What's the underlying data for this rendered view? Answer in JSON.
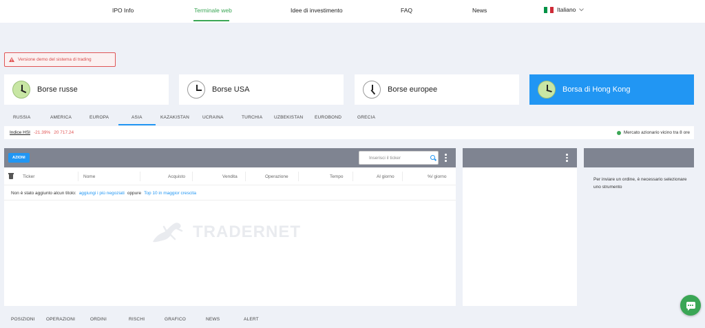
{
  "nav": {
    "items": [
      "IPO Info",
      "Terminale web",
      "Idee di investimento",
      "FAQ",
      "News"
    ],
    "active": "Terminale web",
    "language": "Italiano",
    "flag_colors": [
      "#009246",
      "#ffffff",
      "#ce2b37"
    ]
  },
  "demo_banner": "Versione demo del sistema di trading",
  "exchanges": [
    {
      "label": "Borse russe",
      "icon": "clock-icon"
    },
    {
      "label": "Borse USA",
      "icon": "clock-icon"
    },
    {
      "label": "Borse europee",
      "icon": "clock-icon"
    },
    {
      "label": "Borsa di Hong Kong",
      "icon": "clock-icon",
      "active": true
    }
  ],
  "market_tabs": [
    "RUSSIA",
    "AMERICA",
    "EUROPA",
    "ASIA",
    "KAZAKISTAN",
    "UCRAINA",
    "TURCHIA",
    "UZBEKISTAN",
    "EUROBOND",
    "GRECIA"
  ],
  "active_market_tab": "ASIA",
  "index": {
    "name": "Indice HSI",
    "change": "-21.39%",
    "value": "20 717.24"
  },
  "market_status": "Mercato azionario vicino tra 8 ore",
  "table": {
    "button": "AZIONI",
    "search_placeholder": "Inserisci il ticker",
    "columns": [
      "Ticker",
      "Nome",
      "Acquisto",
      "Vendita",
      "Operazione",
      "Tempo",
      "Al giorno",
      "%/ giorno"
    ],
    "empty_text": "Non è stato aggiunto alcun titolo:",
    "empty_link_1": "aggiungi i più negoziati",
    "empty_or": "oppure",
    "empty_link_2": "Top 10 in maggior crescita",
    "watermark": "TRADERNET"
  },
  "order_info": "Per inviare un ordine, è necessario selezionare uno strumento",
  "bottom_tabs": [
    "POSIZIONI",
    "OPERAZIONI",
    "ORDINI",
    "RISCHI",
    "GRAFICO",
    "NEWS",
    "ALERT"
  ],
  "colors": {
    "accent_green": "#3aa655",
    "accent_blue": "#2196f3",
    "negative_red": "#e05454",
    "panel_header": "#7f8491"
  }
}
